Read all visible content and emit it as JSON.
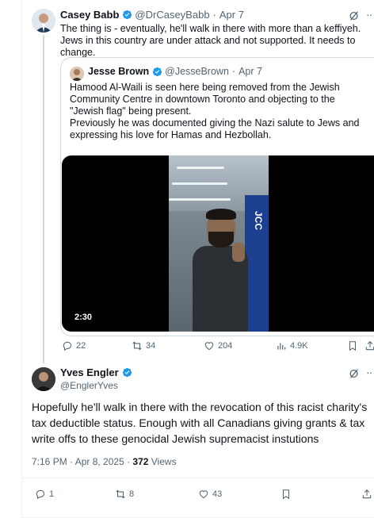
{
  "parent_tweet": {
    "author_name": "Casey Babb",
    "handle": "@DrCaseyBabb",
    "separator": "·",
    "date": "Apr 7",
    "text": "The thing is - eventually, he'll walk in there with more than a keffiyeh. Jews in this country are under attack and not supported. It needs to change.",
    "quote": {
      "author_name": "Jesse Brown",
      "handle": "@JesseBrown",
      "separator": "·",
      "date": "Apr 7",
      "text_line1": "Hamood Al-Waili is seen here being removed from the Jewish Community Centre in downtown Toronto and objecting to the \"Jewish flag\" being present.",
      "text_line2": "Previously he was documented giving the Nazi salute to Jews and expressing his love for Hamas and Hezbollah.",
      "video_duration": "2:30",
      "video_sign_text": "JCC"
    },
    "stats": {
      "replies": "22",
      "reposts": "34",
      "likes": "204",
      "views": "4.9K"
    }
  },
  "main_tweet": {
    "author_name": "Yves Engler",
    "handle": "@EnglerYves",
    "text": "Hopefully he'll walk in there with the revocation of this racist charity's tax deductible status. Enough with all Canadians giving grants & tax write offs to these genocidal Jewish supremacist instutions",
    "timestamp": "7:16 PM · Apr 8, 2025 · ",
    "views_count": "372",
    "views_label": " Views",
    "stats": {
      "replies": "1",
      "reposts": "8",
      "likes": "43"
    }
  },
  "colors": {
    "verified_blue": "#1d9bf0",
    "muted_text": "#536471",
    "border": "#cfd9de"
  },
  "icons": [
    "reply-icon",
    "repost-icon",
    "like-icon",
    "views-icon",
    "bookmark-icon",
    "share-icon",
    "grok-icon",
    "more-icon",
    "verified-badge-icon"
  ]
}
